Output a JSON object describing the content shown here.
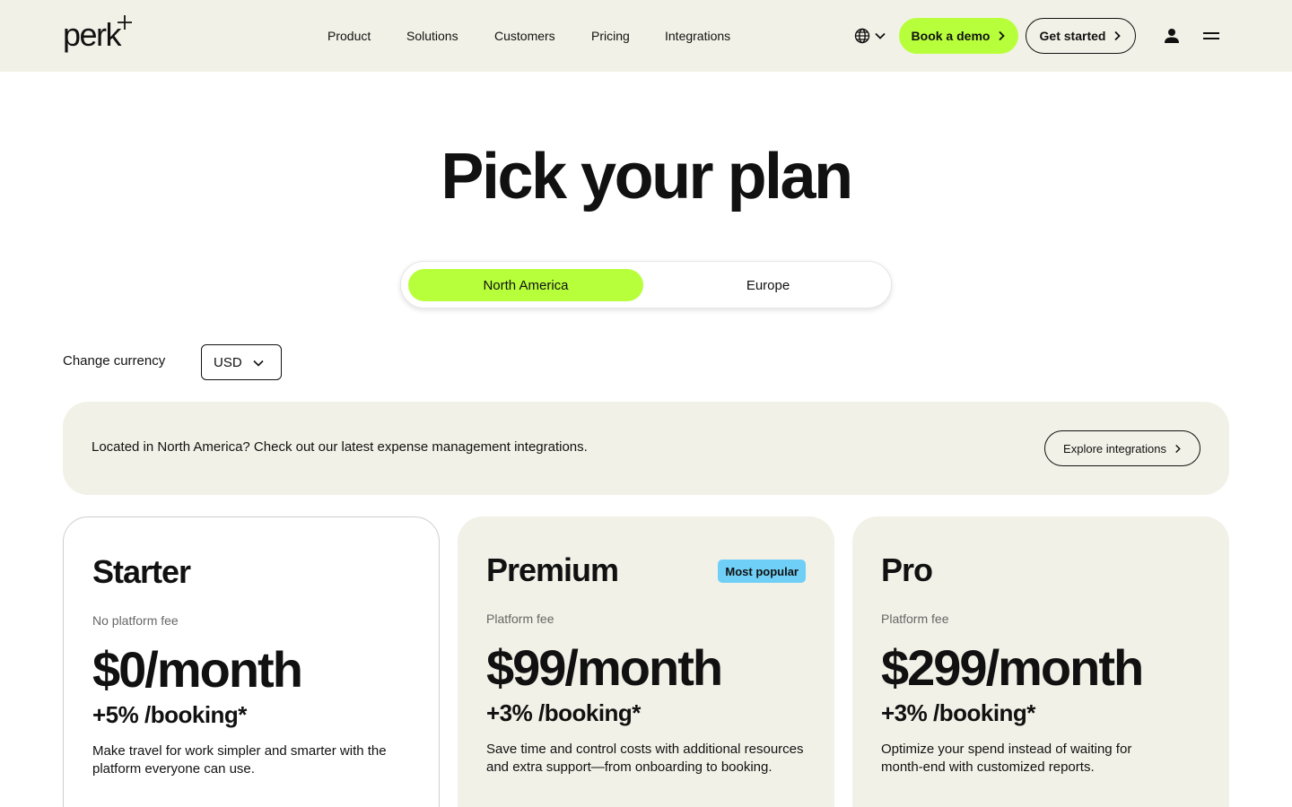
{
  "header": {
    "logo_text": "perk",
    "nav": [
      {
        "label": "Product"
      },
      {
        "label": "Solutions"
      },
      {
        "label": "Customers"
      },
      {
        "label": "Pricing"
      },
      {
        "label": "Integrations"
      }
    ],
    "book_demo_label": "Book a demo",
    "get_started_label": "Get started"
  },
  "hero": {
    "title": "Pick your plan",
    "regions": [
      {
        "label": "North America",
        "active": true
      },
      {
        "label": "Europe",
        "active": false
      }
    ]
  },
  "currency": {
    "label": "Change currency",
    "selected": "USD"
  },
  "banner": {
    "text": "Located in North America? Check out our latest expense management integrations.",
    "button_label": "Explore integrations"
  },
  "plans": [
    {
      "name": "Starter",
      "fee_label": "No platform fee",
      "price": "$0/month",
      "booking": "+5% /booking*",
      "description": "Make travel for work simpler and smarter with the platform everyone can use."
    },
    {
      "name": "Premium",
      "badge": "Most popular",
      "fee_label": "Platform fee",
      "price": "$99/month",
      "booking": "+3% /booking*",
      "description": "Save time and control costs with additional resources and extra support—from onboarding to booking."
    },
    {
      "name": "Pro",
      "fee_label": "Platform fee",
      "price": "$299/month",
      "booking": "+3% /booking*",
      "description": "Optimize your spend instead of waiting for month-end with customized reports."
    }
  ],
  "colors": {
    "accent": "#b7ff3b",
    "header_bg": "#f2f1e7",
    "badge": "#6fcff7"
  }
}
